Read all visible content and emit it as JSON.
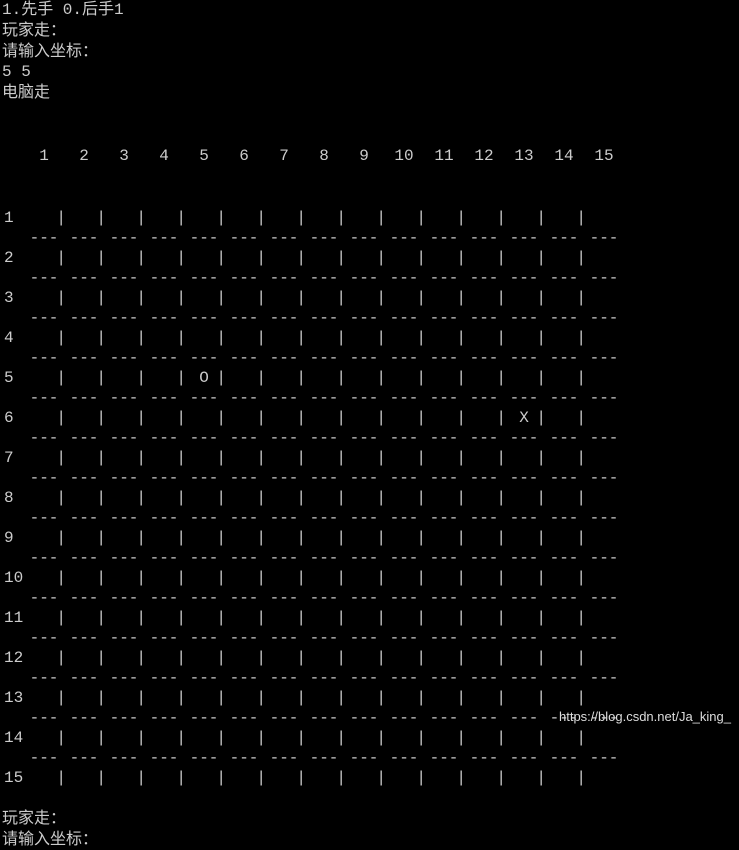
{
  "prompts": {
    "choose_first": "1.先手 0.后手1",
    "player_turn": "玩家走：",
    "enter_coord": "请输入坐标：",
    "input_value": "5 5",
    "computer_turn": "电脑走",
    "player_turn2": "玩家走：",
    "enter_coord2": "请输入坐标："
  },
  "board": {
    "size": 15,
    "columns": [
      "1",
      "2",
      "3",
      "4",
      "5",
      "6",
      "7",
      "8",
      "9",
      "10",
      "11",
      "12",
      "13",
      "14",
      "15"
    ],
    "rows": [
      "1",
      "2",
      "3",
      "4",
      "5",
      "6",
      "7",
      "8",
      "9",
      "10",
      "11",
      "12",
      "13",
      "14",
      "15"
    ],
    "cells": {
      "5_5": "O",
      "6_13": "X"
    },
    "cell_separator": "|",
    "row_separator": "---"
  },
  "watermark": "https://blog.csdn.net/Ja_king_",
  "chart_data": {
    "type": "table",
    "title": "Gomoku Board 15x15",
    "player_piece": "O",
    "computer_piece": "X",
    "moves": [
      {
        "player": "human",
        "row": 5,
        "col": 5,
        "symbol": "O"
      },
      {
        "player": "computer",
        "row": 6,
        "col": 13,
        "symbol": "X"
      }
    ]
  }
}
